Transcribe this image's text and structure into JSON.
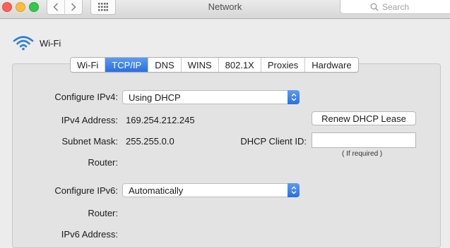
{
  "window": {
    "title": "Network"
  },
  "toolbar": {
    "search_placeholder": "Search"
  },
  "interface": {
    "name": "Wi-Fi"
  },
  "tabs": [
    {
      "label": "Wi-Fi",
      "active": false
    },
    {
      "label": "TCP/IP",
      "active": true
    },
    {
      "label": "DNS",
      "active": false
    },
    {
      "label": "WINS",
      "active": false
    },
    {
      "label": "802.1X",
      "active": false
    },
    {
      "label": "Proxies",
      "active": false
    },
    {
      "label": "Hardware",
      "active": false
    }
  ],
  "tcpip": {
    "configure_ipv4_label": "Configure IPv4:",
    "configure_ipv4_value": "Using DHCP",
    "ipv4_address_label": "IPv4 Address:",
    "ipv4_address_value": "169.254.212.245",
    "subnet_mask_label": "Subnet Mask:",
    "subnet_mask_value": "255.255.0.0",
    "router_label": "Router:",
    "router_value": "",
    "renew_button": "Renew DHCP Lease",
    "dhcp_client_id_label": "DHCP Client ID:",
    "dhcp_client_id_value": "",
    "dhcp_hint": "( If required )",
    "configure_ipv6_label": "Configure IPv6:",
    "configure_ipv6_value": "Automatically",
    "router6_label": "Router:",
    "ipv6_address_label": "IPv6 Address:"
  },
  "colors": {
    "accent": "#2a6fde",
    "wifi_icon": "#2c7de0"
  }
}
